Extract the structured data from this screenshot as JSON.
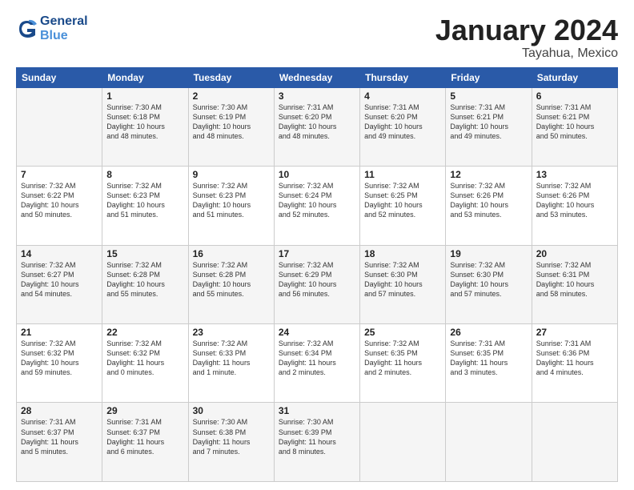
{
  "header": {
    "logo_line1": "General",
    "logo_line2": "Blue",
    "month": "January 2024",
    "location": "Tayahua, Mexico"
  },
  "weekdays": [
    "Sunday",
    "Monday",
    "Tuesday",
    "Wednesday",
    "Thursday",
    "Friday",
    "Saturday"
  ],
  "weeks": [
    [
      {
        "day": "",
        "info": ""
      },
      {
        "day": "1",
        "info": "Sunrise: 7:30 AM\nSunset: 6:18 PM\nDaylight: 10 hours\nand 48 minutes."
      },
      {
        "day": "2",
        "info": "Sunrise: 7:30 AM\nSunset: 6:19 PM\nDaylight: 10 hours\nand 48 minutes."
      },
      {
        "day": "3",
        "info": "Sunrise: 7:31 AM\nSunset: 6:20 PM\nDaylight: 10 hours\nand 48 minutes."
      },
      {
        "day": "4",
        "info": "Sunrise: 7:31 AM\nSunset: 6:20 PM\nDaylight: 10 hours\nand 49 minutes."
      },
      {
        "day": "5",
        "info": "Sunrise: 7:31 AM\nSunset: 6:21 PM\nDaylight: 10 hours\nand 49 minutes."
      },
      {
        "day": "6",
        "info": "Sunrise: 7:31 AM\nSunset: 6:21 PM\nDaylight: 10 hours\nand 50 minutes."
      }
    ],
    [
      {
        "day": "7",
        "info": "Sunrise: 7:32 AM\nSunset: 6:22 PM\nDaylight: 10 hours\nand 50 minutes."
      },
      {
        "day": "8",
        "info": "Sunrise: 7:32 AM\nSunset: 6:23 PM\nDaylight: 10 hours\nand 51 minutes."
      },
      {
        "day": "9",
        "info": "Sunrise: 7:32 AM\nSunset: 6:23 PM\nDaylight: 10 hours\nand 51 minutes."
      },
      {
        "day": "10",
        "info": "Sunrise: 7:32 AM\nSunset: 6:24 PM\nDaylight: 10 hours\nand 52 minutes."
      },
      {
        "day": "11",
        "info": "Sunrise: 7:32 AM\nSunset: 6:25 PM\nDaylight: 10 hours\nand 52 minutes."
      },
      {
        "day": "12",
        "info": "Sunrise: 7:32 AM\nSunset: 6:26 PM\nDaylight: 10 hours\nand 53 minutes."
      },
      {
        "day": "13",
        "info": "Sunrise: 7:32 AM\nSunset: 6:26 PM\nDaylight: 10 hours\nand 53 minutes."
      }
    ],
    [
      {
        "day": "14",
        "info": "Sunrise: 7:32 AM\nSunset: 6:27 PM\nDaylight: 10 hours\nand 54 minutes."
      },
      {
        "day": "15",
        "info": "Sunrise: 7:32 AM\nSunset: 6:28 PM\nDaylight: 10 hours\nand 55 minutes."
      },
      {
        "day": "16",
        "info": "Sunrise: 7:32 AM\nSunset: 6:28 PM\nDaylight: 10 hours\nand 55 minutes."
      },
      {
        "day": "17",
        "info": "Sunrise: 7:32 AM\nSunset: 6:29 PM\nDaylight: 10 hours\nand 56 minutes."
      },
      {
        "day": "18",
        "info": "Sunrise: 7:32 AM\nSunset: 6:30 PM\nDaylight: 10 hours\nand 57 minutes."
      },
      {
        "day": "19",
        "info": "Sunrise: 7:32 AM\nSunset: 6:30 PM\nDaylight: 10 hours\nand 57 minutes."
      },
      {
        "day": "20",
        "info": "Sunrise: 7:32 AM\nSunset: 6:31 PM\nDaylight: 10 hours\nand 58 minutes."
      }
    ],
    [
      {
        "day": "21",
        "info": "Sunrise: 7:32 AM\nSunset: 6:32 PM\nDaylight: 10 hours\nand 59 minutes."
      },
      {
        "day": "22",
        "info": "Sunrise: 7:32 AM\nSunset: 6:32 PM\nDaylight: 11 hours\nand 0 minutes."
      },
      {
        "day": "23",
        "info": "Sunrise: 7:32 AM\nSunset: 6:33 PM\nDaylight: 11 hours\nand 1 minute."
      },
      {
        "day": "24",
        "info": "Sunrise: 7:32 AM\nSunset: 6:34 PM\nDaylight: 11 hours\nand 2 minutes."
      },
      {
        "day": "25",
        "info": "Sunrise: 7:32 AM\nSunset: 6:35 PM\nDaylight: 11 hours\nand 2 minutes."
      },
      {
        "day": "26",
        "info": "Sunrise: 7:31 AM\nSunset: 6:35 PM\nDaylight: 11 hours\nand 3 minutes."
      },
      {
        "day": "27",
        "info": "Sunrise: 7:31 AM\nSunset: 6:36 PM\nDaylight: 11 hours\nand 4 minutes."
      }
    ],
    [
      {
        "day": "28",
        "info": "Sunrise: 7:31 AM\nSunset: 6:37 PM\nDaylight: 11 hours\nand 5 minutes."
      },
      {
        "day": "29",
        "info": "Sunrise: 7:31 AM\nSunset: 6:37 PM\nDaylight: 11 hours\nand 6 minutes."
      },
      {
        "day": "30",
        "info": "Sunrise: 7:30 AM\nSunset: 6:38 PM\nDaylight: 11 hours\nand 7 minutes."
      },
      {
        "day": "31",
        "info": "Sunrise: 7:30 AM\nSunset: 6:39 PM\nDaylight: 11 hours\nand 8 minutes."
      },
      {
        "day": "",
        "info": ""
      },
      {
        "day": "",
        "info": ""
      },
      {
        "day": "",
        "info": ""
      }
    ]
  ]
}
